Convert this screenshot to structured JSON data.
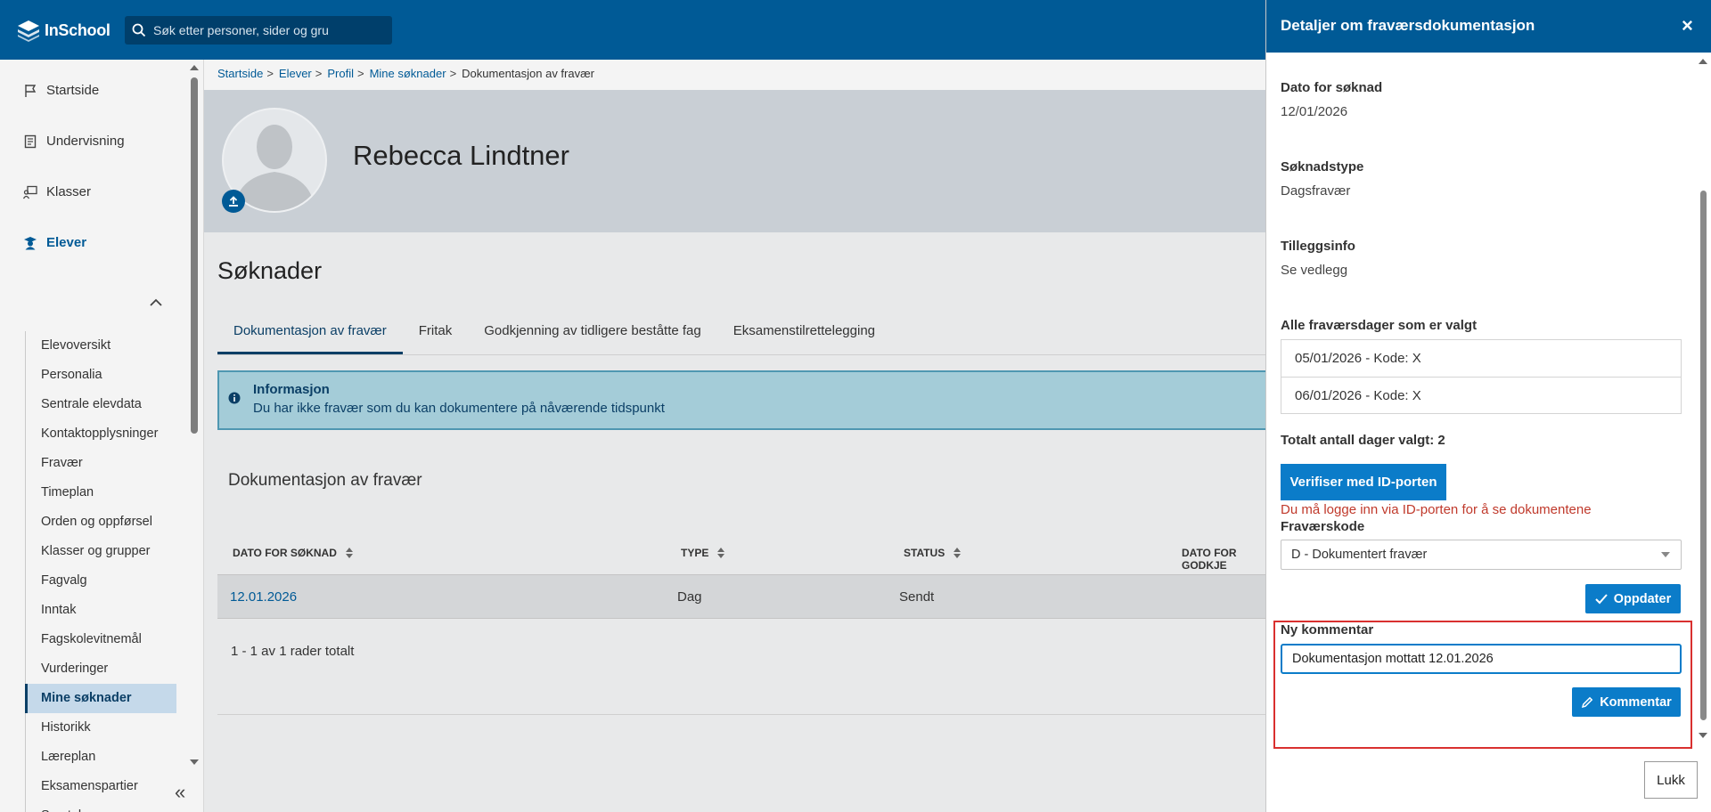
{
  "header": {
    "app_name": "InSchool",
    "search_placeholder": "Søk etter personer, sider og gru"
  },
  "sidebar": {
    "main_items": [
      {
        "label": "Startside",
        "icon": "flag-icon"
      },
      {
        "label": "Undervisning",
        "icon": "book-icon"
      },
      {
        "label": "Klasser",
        "icon": "classroom-icon"
      },
      {
        "label": "Elever",
        "icon": "student-icon"
      }
    ],
    "sub_items": [
      "Elevoversikt",
      "Personalia",
      "Sentrale elevdata",
      "Kontaktopplysninger",
      "Fravær",
      "Timeplan",
      "Orden og oppførsel",
      "Klasser og grupper",
      "Fagvalg",
      "Inntak",
      "Fagskolevitnemål",
      "Vurderinger",
      "Mine søknader",
      "Historikk",
      "Læreplan",
      "Eksamenspartier",
      "Samtaler"
    ],
    "active_sub_item": "Mine søknader",
    "collapse_label": "«"
  },
  "breadcrumb": {
    "items": [
      "Startside",
      "Elever",
      "Profil",
      "Mine søknader"
    ],
    "current": "Dokumentasjon av fravær"
  },
  "profile": {
    "name": "Rebecca Lindtner"
  },
  "main": {
    "page_title": "Søknader",
    "tabs": [
      "Dokumentasjon av fravær",
      "Fritak",
      "Godkjenning av tidligere beståtte fag",
      "Eksamenstilrettelegging"
    ],
    "active_tab": "Dokumentasjon av fravær",
    "info": {
      "title": "Informasjon",
      "text": "Du har ikke fravær som du kan dokumentere på nåværende tidspunkt"
    },
    "table": {
      "title": "Dokumentasjon av fravær",
      "columns": [
        "DATO FOR SØKNAD",
        "TYPE",
        "STATUS",
        "DATO FOR GODKJE"
      ],
      "rows": [
        {
          "date": "12.01.2026",
          "type": "Dag",
          "status": "Sendt"
        }
      ],
      "row_count": "1 - 1 av 1 rader totalt"
    }
  },
  "drawer": {
    "title": "Detaljer om fraværsdokumentasjon",
    "close_label": "×",
    "date_label": "Dato for søknad",
    "date_value": "12/01/2026",
    "type_label": "Søknadstype",
    "type_value": "Dagsfravær",
    "extra_label": "Tilleggsinfo",
    "extra_value": "Se vedlegg",
    "days_label": "Alle fraværsdager som er valgt",
    "days": [
      "05/01/2026 - Kode: X",
      "06/01/2026 - Kode: X"
    ],
    "total_label": "Totalt antall dager valgt: 2",
    "verify_button": "Verifiser med ID-porten",
    "error_text": "Du må logge inn via ID-porten for å se dokumentene",
    "absence_code_label": "Fraværskode",
    "absence_code_value": "D - Dokumentert fravær",
    "update_button": "Oppdater",
    "comment_label": "Ny kommentar",
    "comment_value": "Dokumentasjon mottatt 12.01.2026",
    "comment_button": "Kommentar",
    "close_button": "Lukk"
  },
  "colors": {
    "brand": "#005a96",
    "button": "#0b7cc9",
    "error": "#c0392b",
    "highlight": "#d9302f"
  }
}
